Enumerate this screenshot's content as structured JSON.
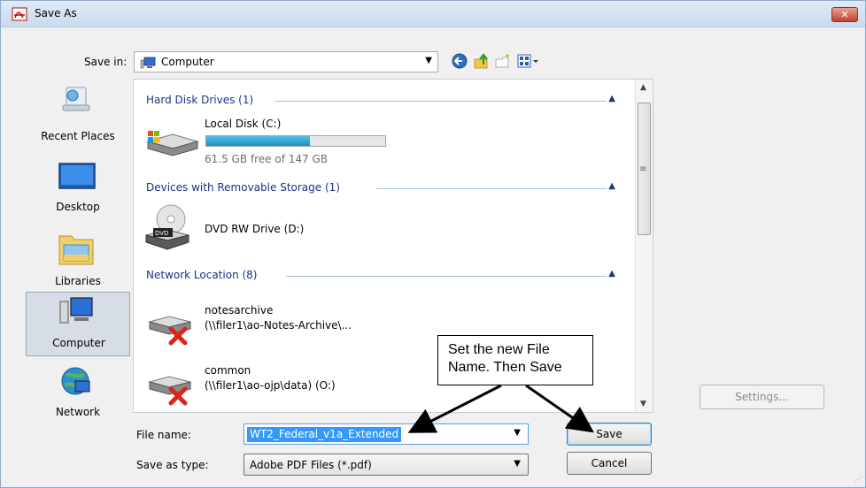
{
  "window": {
    "title": "Save As",
    "close_label": "✕"
  },
  "toolbar": {
    "save_in_label": "Save in:",
    "save_in_value": "Computer",
    "icons": [
      "back-icon",
      "up-folder-icon",
      "new-folder-icon",
      "views-menu-icon"
    ]
  },
  "places": [
    {
      "label": "Recent Places",
      "icon": "recent-places-icon",
      "selected": false
    },
    {
      "label": "Desktop",
      "icon": "desktop-icon",
      "selected": false
    },
    {
      "label": "Libraries",
      "icon": "libraries-icon",
      "selected": false
    },
    {
      "label": "Computer",
      "icon": "computer-icon",
      "selected": true
    },
    {
      "label": "Network",
      "icon": "network-icon",
      "selected": false
    }
  ],
  "groups": {
    "hard_disks": {
      "header": "Hard Disk Drives (1)",
      "items": [
        {
          "name": "Local Disk (C:)",
          "free_text": "61.5 GB free of 147 GB",
          "used_fraction": 0.58
        }
      ]
    },
    "removable": {
      "header": "Devices with Removable Storage (1)",
      "items": [
        {
          "name": "DVD RW Drive (D:)"
        }
      ]
    },
    "network": {
      "header": "Network Location (8)",
      "items": [
        {
          "name": "notesarchive",
          "path": "(\\\\filer1\\ao-Notes-Archive\\..."
        },
        {
          "name": "common",
          "path": "(\\\\filer1\\ao-ojp\\data) (O:)"
        }
      ]
    }
  },
  "form": {
    "file_name_label": "File name:",
    "file_name_value": "WT2_Federal_v1a_Extended",
    "save_as_type_label": "Save as type:",
    "save_as_type_value": "Adobe PDF Files (*.pdf)"
  },
  "buttons": {
    "save": "Save",
    "cancel": "Cancel",
    "settings": "Settings..."
  },
  "annotation": {
    "line1": "Set the new File",
    "line2": "Name. Then Save"
  },
  "colors": {
    "group_header": "#1e3287",
    "selection": "#3399ff",
    "disk_fill": "#1e8fbf"
  }
}
